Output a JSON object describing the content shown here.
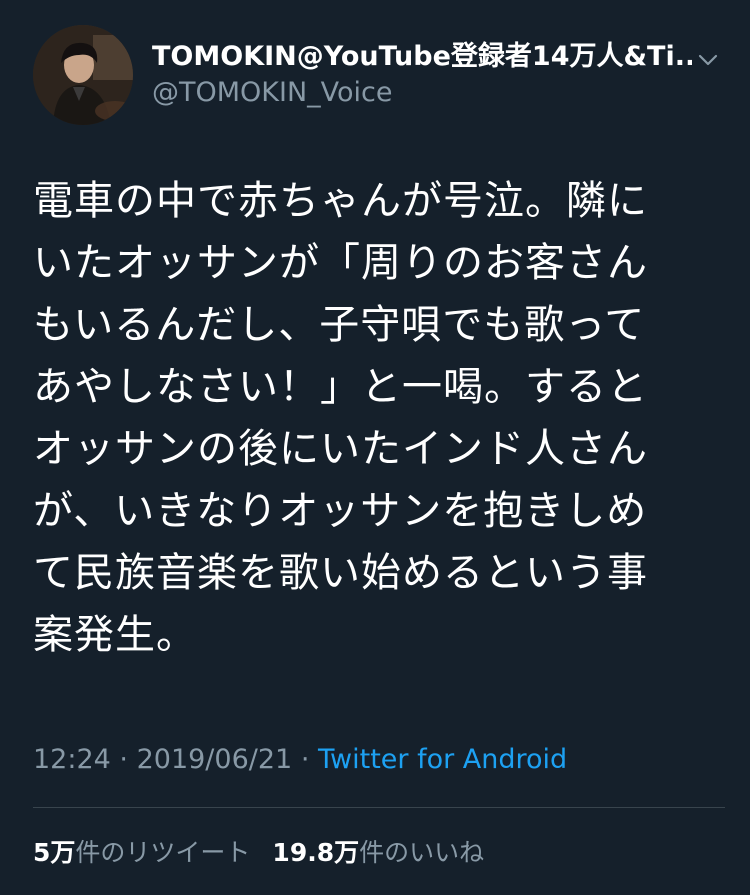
{
  "tweet": {
    "author": {
      "display_name": "TOMOKIN@YouTube登録者14万人&Ti...",
      "handle": "@TOMOKIN_Voice",
      "avatar_icon": "user-avatar"
    },
    "menu_icon": "chevron-down-icon",
    "text_lines": [
      "電車の中で赤ちゃんが号泣。隣に",
      "いたオッサンが「周りのお客さん",
      "もいるんだし、子守唄でも歌って",
      "あやしなさい！」と一喝。すると",
      "オッサンの後にいたインド人さん",
      "が、いきなりオッサンを抱きしめ",
      "て民族音楽を歌い始めるという事",
      "案発生。"
    ],
    "time": "12:24",
    "separator": "·",
    "date": "2019/06/21",
    "source": "Twitter for Android",
    "retweets": {
      "count": "5万",
      "label": "件のリツイート"
    },
    "likes": {
      "count": "19.8万",
      "label": "件のいいね"
    }
  },
  "colors": {
    "background": "#15202b",
    "primary_text": "#ffffff",
    "secondary_text": "#8899a6",
    "link": "#1da1f2",
    "divider": "#38444d"
  }
}
